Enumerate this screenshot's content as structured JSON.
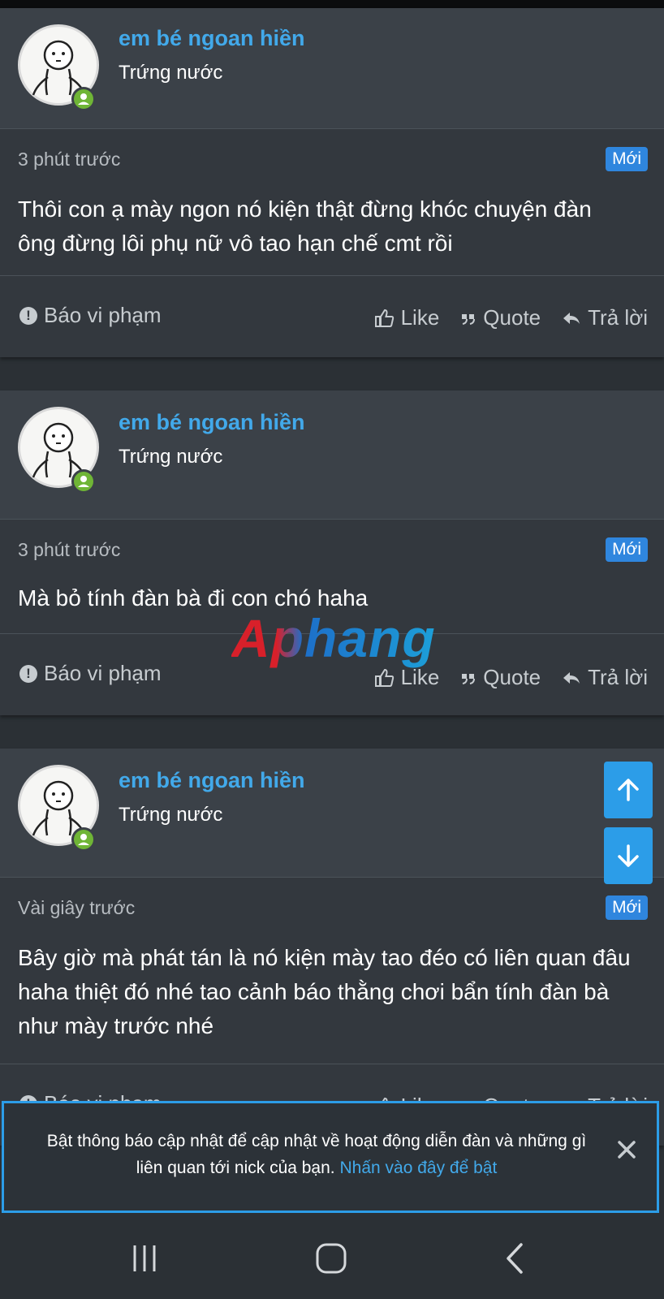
{
  "posts": [
    {
      "username": "em bé ngoan hiền",
      "user_title": "Trứng nước",
      "timestamp": "3 phút trước",
      "badge": "Mới",
      "message": "Thôi con ạ mày ngon nó kiện thật đừng khóc chuyện đàn ông đừng lôi phụ nữ vô tao hạn chế cmt rồi"
    },
    {
      "username": "em bé ngoan hiền",
      "user_title": "Trứng nước",
      "timestamp": "3 phút trước",
      "badge": "Mới",
      "message": "Mà bỏ tính đàn bà đi con chó haha"
    },
    {
      "username": "em bé ngoan hiền",
      "user_title": "Trứng nước",
      "timestamp": "Vài giây trước",
      "badge": "Mới",
      "message": "Bây giờ mà phát tán là nó kiện mày tao đéo có liên quan đâu haha thiệt đó nhé tao cảnh báo thằng chơi bẩn tính đàn bà như mày trước nhé"
    }
  ],
  "actions": {
    "report_label": "Báo vi phạm",
    "like_label": "Like",
    "quote_label": "Quote",
    "reply_label": "Trả lời"
  },
  "watermark": "Aphang",
  "notice": {
    "text": "Bật thông báo cập nhật để cập nhật về hoạt động diễn đàn và những gì liên quan tới nick của bạn.",
    "link_text": "Nhấn vào đây để bật"
  },
  "icons": {
    "scroll_up": "arrow-up-icon",
    "scroll_down": "arrow-down-icon",
    "close": "close-icon",
    "recents": "recents-icon",
    "home": "home-icon",
    "back": "back-icon"
  },
  "colors": {
    "accent": "#2c9de8",
    "username": "#42a9ea",
    "badge": "#2f86de",
    "online": "#6fb536"
  }
}
